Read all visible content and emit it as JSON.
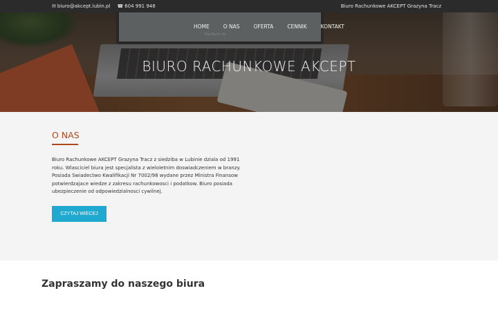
{
  "topbar": {
    "email_icon": "envelope-icon",
    "email": "biuro@akcept.lubin.pl",
    "phone_icon": "phone-icon",
    "phone": "604 991 948",
    "company": "Biuro Rachunkowe AKCEPT Grazyna Tracz"
  },
  "nav": {
    "items": [
      {
        "label": "HOME"
      },
      {
        "label": "O NAS"
      },
      {
        "label": "OFERTA"
      },
      {
        "label": "CENNIK"
      },
      {
        "label": "KONTAKT"
      }
    ]
  },
  "hero": {
    "title": "BIURO RACHUNKOWE AKCEPT",
    "laptop_brand": "MacBook Air"
  },
  "about": {
    "heading": "O NAS",
    "text": "Biuro Rachunkowe AKCEPT Grazyna Tracz z siedziba w Lubinie dziala od 1991 roku. Wlasciciel biura jest specjalista z wieloletnim doswiadczeniem w branzy. Posiada Swiadectwo Kwalifikacji Nr 7002/98 wydane przez Ministra Finansow potwierdzajace wiedze z zakresu rachunkowosci i podatkow. Biuro posiada ubezpieczenie od odpowiedzialnosci cywilnej.",
    "button": "CZYTAJ WIECEJ"
  },
  "welcome": {
    "heading": "Zapraszamy do naszego biura"
  },
  "colors": {
    "topbar_bg": "#2b2b2b",
    "accent": "#b0461d",
    "button": "#1fa9d1",
    "section_bg": "#f4f4f4"
  }
}
